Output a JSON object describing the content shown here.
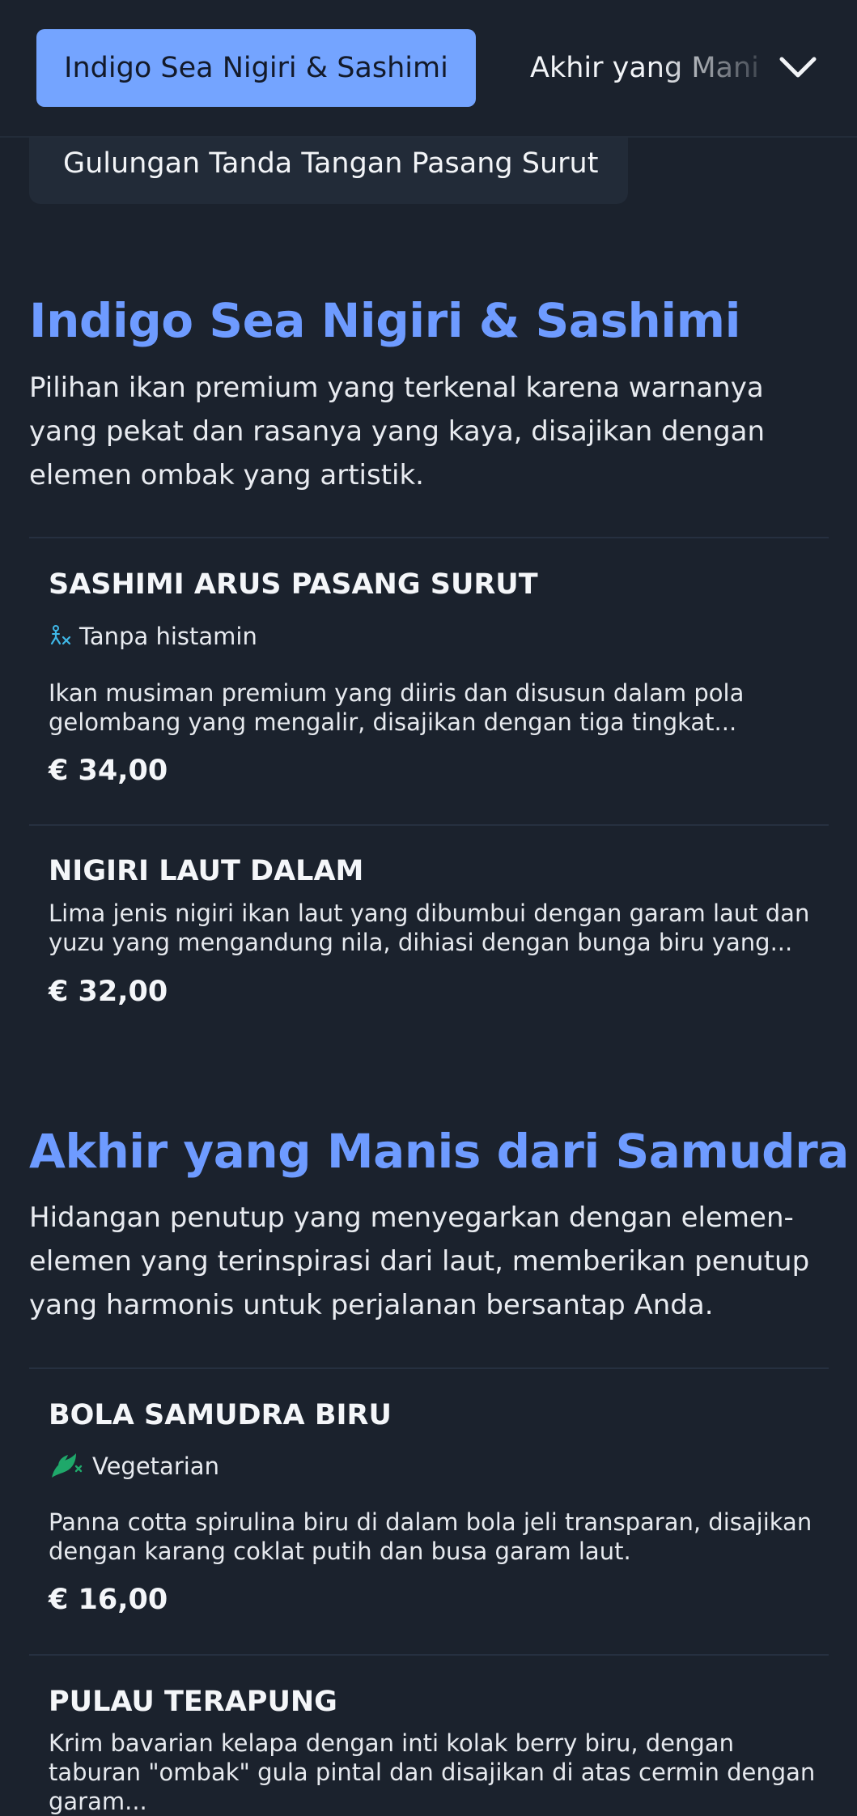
{
  "nav": {
    "active_category": "Indigo Sea Nigiri & Sashimi",
    "next_category": "Akhir yang Manis dari Samudra",
    "previous_category": "Gulungan Tanda Tangan Pasang Surut",
    "expand_icon": "chevron-down-icon"
  },
  "sections": [
    {
      "title": "Indigo Sea Nigiri & Sashimi",
      "description": "Pilihan ikan premium yang terkenal karena warnanya yang pekat dan rasanya yang kaya, disajikan dengan elemen ombak yang artistik.",
      "items": [
        {
          "name": "SASHIMI ARUS PASANG SURUT",
          "diet_label": "Tanpa histamin",
          "diet_icon": "no-histamine-icon",
          "description": "Ikan musiman premium yang diiris dan disusun dalam pola gelombang yang mengalir, disajikan dengan tiga tingkat...",
          "price": "€ 34,00"
        },
        {
          "name": "NIGIRI LAUT DALAM",
          "description": "Lima jenis nigiri ikan laut yang dibumbui dengan garam laut dan yuzu yang mengandung nila, dihiasi dengan bunga biru yang...",
          "price": "€ 32,00"
        }
      ]
    },
    {
      "title": "Akhir yang Manis dari Samudra",
      "description": "Hidangan penutup yang menyegarkan dengan elemen-elemen yang terinspirasi dari laut, memberikan penutup yang harmonis untuk perjalanan bersantap Anda.",
      "items": [
        {
          "name": "BOLA SAMUDRA BIRU",
          "diet_label": "Vegetarian",
          "diet_icon": "vegetarian-icon",
          "description": "Panna cotta spirulina biru di dalam bola jeli transparan, disajikan dengan karang coklat putih dan busa garam laut.",
          "price": "€ 16,00"
        },
        {
          "name": "PULAU TERAPUNG",
          "description": "Krim bavarian kelapa dengan inti kolak berry biru, dengan taburan \"ombak\" gula pintal dan disajikan di atas cermin dengan garam..."
        }
      ]
    }
  ],
  "colors": {
    "background": "#1b222d",
    "accent": "#6e9bff",
    "active_tab": "#74a4ff",
    "no_histamine_icon": "#3fb8e8",
    "vegetarian_icon": "#1fa86a"
  }
}
